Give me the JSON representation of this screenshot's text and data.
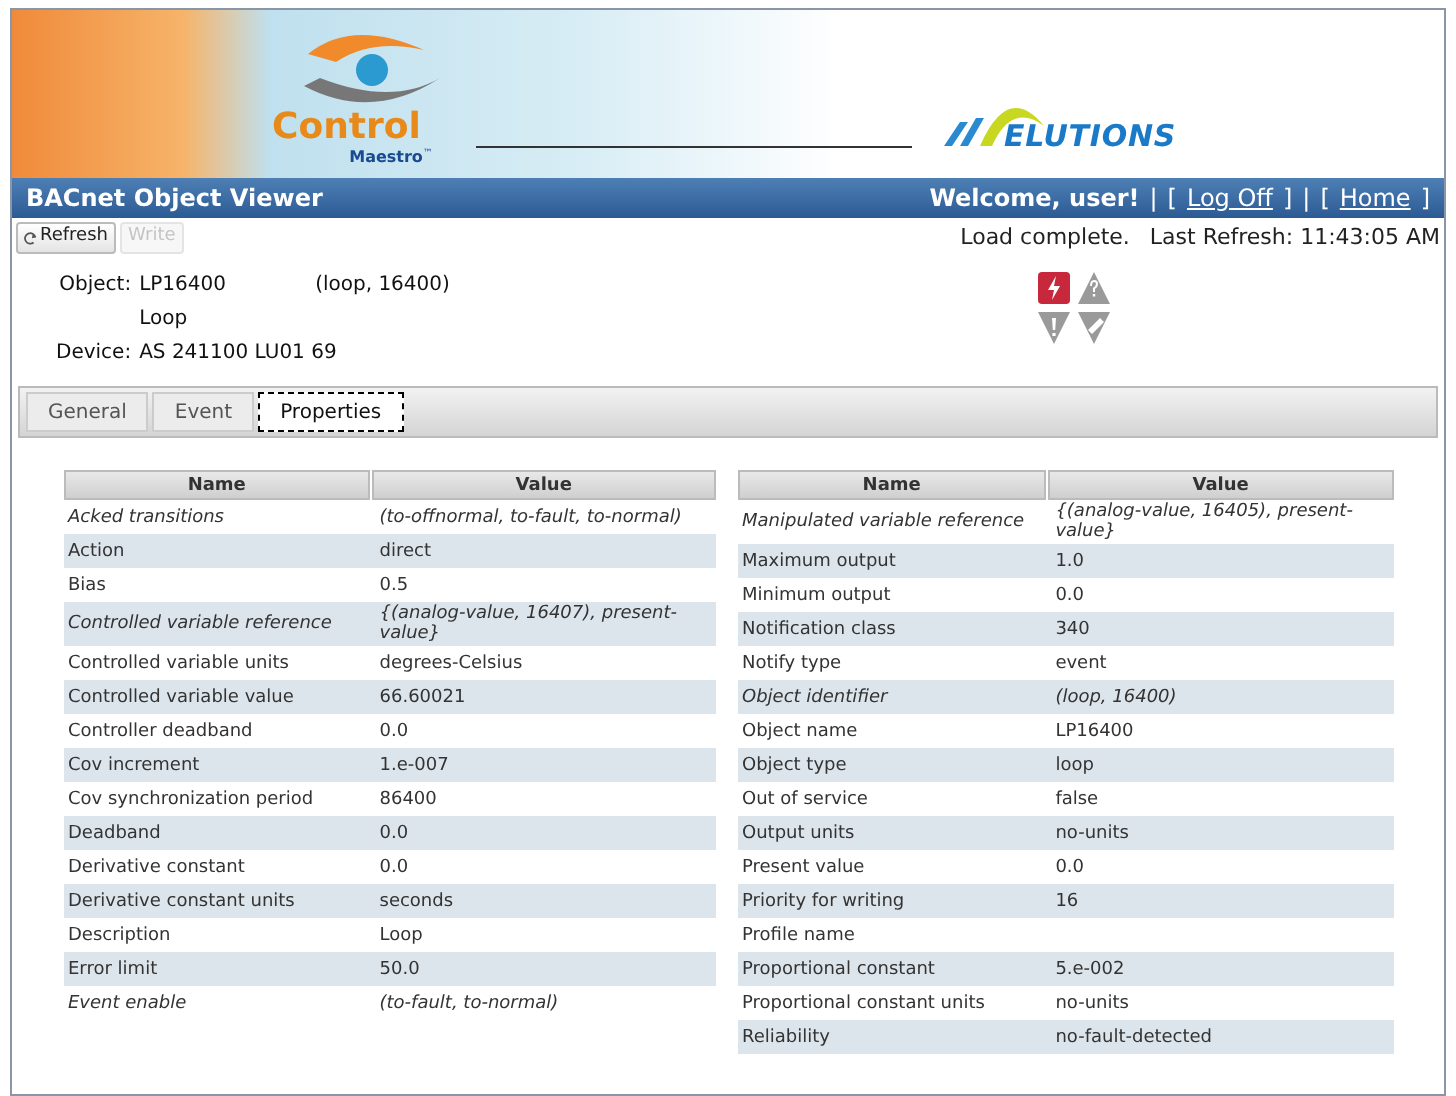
{
  "banner": {
    "logo_word": "Control",
    "logo_sub": "Maestro",
    "logo_mark": "™",
    "partner": "ELUTIONS"
  },
  "title_bar": {
    "title": "BACnet Object Viewer",
    "welcome": "Welcome, user!",
    "separator": "|",
    "links": [
      {
        "open": "[",
        "label": "Log Off",
        "close": "]"
      },
      {
        "open": "[",
        "label": "Home",
        "close": "]"
      }
    ]
  },
  "toolbar": {
    "buttons": [
      {
        "label": "Refresh",
        "disabled": false
      },
      {
        "label": "Write",
        "disabled": true
      }
    ],
    "status": "Load complete.",
    "last_refresh": "Last Refresh: 11:43:05 AM"
  },
  "object": {
    "object_label": "Object:",
    "object_name": "LP16400",
    "object_id": "(loop, 16400)",
    "description": "Loop",
    "device_label": "Device:",
    "device": "AS 241100 LU01 69"
  },
  "status_flags": [
    {
      "kind": "alarm",
      "active": true
    },
    {
      "kind": "unknown",
      "active": false
    },
    {
      "kind": "fault",
      "active": false
    },
    {
      "kind": "override",
      "active": false
    }
  ],
  "tabs": [
    {
      "label": "General",
      "selected": false
    },
    {
      "label": "Event",
      "selected": false
    },
    {
      "label": "Properties",
      "selected": true
    }
  ],
  "tables": [
    {
      "columns": [
        "Name",
        "Value"
      ],
      "rows": [
        {
          "name": "Acked transitions",
          "value": "(to-offnormal, to-fault, to-normal)",
          "italic": true
        },
        {
          "name": "Action",
          "value": "direct",
          "italic": false
        },
        {
          "name": "Bias",
          "value": "0.5",
          "italic": false
        },
        {
          "name": "Controlled variable reference",
          "value": "{(analog-value, 16407), present-value}",
          "italic": true
        },
        {
          "name": "Controlled variable units",
          "value": "degrees-Celsius",
          "italic": false
        },
        {
          "name": "Controlled variable value",
          "value": "66.60021",
          "italic": false
        },
        {
          "name": "Controller deadband",
          "value": "0.0",
          "italic": false
        },
        {
          "name": "Cov increment",
          "value": "1.e-007",
          "italic": false
        },
        {
          "name": "Cov synchronization period",
          "value": "86400",
          "italic": false
        },
        {
          "name": "Deadband",
          "value": "0.0",
          "italic": false
        },
        {
          "name": "Derivative constant",
          "value": "0.0",
          "italic": false
        },
        {
          "name": "Derivative constant units",
          "value": "seconds",
          "italic": false
        },
        {
          "name": "Description",
          "value": "Loop",
          "italic": false
        },
        {
          "name": "Error limit",
          "value": "50.0",
          "italic": false
        },
        {
          "name": "Event enable",
          "value": "(to-fault, to-normal)",
          "italic": true
        }
      ]
    },
    {
      "columns": [
        "Name",
        "Value"
      ],
      "rows": [
        {
          "name": "Manipulated variable reference",
          "value": "{(analog-value, 16405), present-value}",
          "italic": true
        },
        {
          "name": "Maximum output",
          "value": "1.0",
          "italic": false
        },
        {
          "name": "Minimum output",
          "value": "0.0",
          "italic": false
        },
        {
          "name": "Notification class",
          "value": "340",
          "italic": false
        },
        {
          "name": "Notify type",
          "value": "event",
          "italic": false
        },
        {
          "name": "Object identifier",
          "value": "(loop, 16400)",
          "italic": true
        },
        {
          "name": "Object name",
          "value": "LP16400",
          "italic": false
        },
        {
          "name": "Object type",
          "value": "loop",
          "italic": false
        },
        {
          "name": "Out of service",
          "value": "false",
          "italic": false
        },
        {
          "name": "Output units",
          "value": "no-units",
          "italic": false
        },
        {
          "name": "Present value",
          "value": "0.0",
          "italic": false
        },
        {
          "name": "Priority for writing",
          "value": "16",
          "italic": false
        },
        {
          "name": "Profile name",
          "italic": false
        },
        {
          "name": "Proportional constant",
          "value": "5.e-002",
          "italic": false
        },
        {
          "name": "Proportional constant units",
          "value": "no-units",
          "italic": false
        },
        {
          "name": "Reliability",
          "value": "no-fault-detected",
          "italic": false
        }
      ]
    }
  ]
}
